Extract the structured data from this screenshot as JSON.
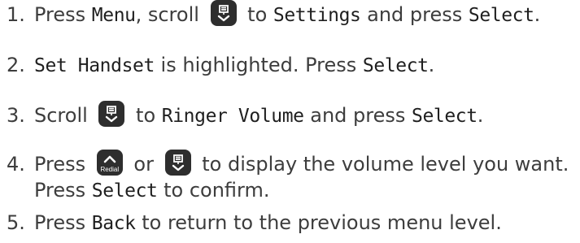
{
  "steps": [
    {
      "num": "1.",
      "p1": "Press ",
      "l1": "Menu",
      "p2": ", scroll ",
      "p3": " to ",
      "l2": "Settings",
      "p4": " and press ",
      "l3": "Select",
      "p5": "."
    },
    {
      "num": "2.",
      "l1": "Set Handset",
      "p1": " is highlighted. Press ",
      "l2": "Select",
      "p2": "."
    },
    {
      "num": "3.",
      "p1": "Scroll ",
      "p2": " to ",
      "l1": "Ringer Volume",
      "p3": " and press ",
      "l2": "Select",
      "p4": "."
    },
    {
      "num": "4.",
      "p1": "Press ",
      "p2": " or ",
      "p3": " to display the volume level you want.",
      "line2_p1": "Press ",
      "line2_l1": "Select",
      "line2_p2": " to confirm."
    },
    {
      "num": "5.",
      "p1": "Press ",
      "l1": "Back",
      "p2": " to return to the previous menu level."
    }
  ],
  "icons": {
    "redial_label": "Redial",
    "scroll_icon": "phonebook-down-scroll-icon",
    "redial_icon": "redial-up-icon"
  },
  "colors": {
    "text": "#3d3d3d",
    "display_text": "#1f1f1f",
    "button_bg": "#2e2e2e",
    "button_glyph": "#ffffff"
  }
}
